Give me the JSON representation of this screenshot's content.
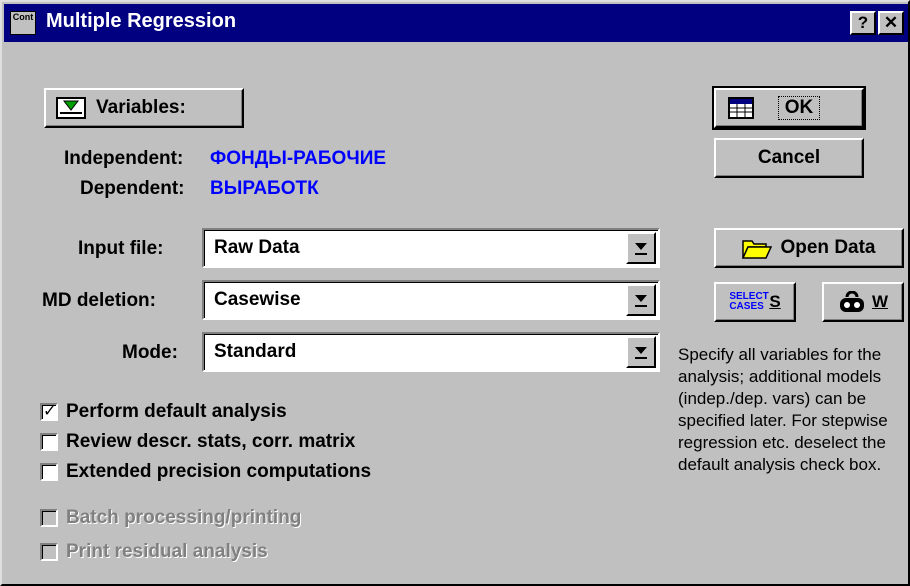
{
  "window": {
    "icon_text": "Cont",
    "title": "Multiple Regression",
    "help_label": "?",
    "close_label": "✕"
  },
  "variables": {
    "button_label": "Variables:",
    "independent_label": "Independent:",
    "independent_value": "ФОНДЫ-РАБОЧИЕ",
    "dependent_label": "Dependent:",
    "dependent_value": "ВЫРАБОТК"
  },
  "actions": {
    "ok_label": "OK",
    "cancel_label": "Cancel",
    "open_data_label": "Open Data",
    "select_cases_icon_text": "SELECT CASES",
    "select_cases_label": "S",
    "weight_label": "W"
  },
  "fields": {
    "input_file_label": "Input file:",
    "input_file_value": "Raw Data",
    "md_deletion_label": "MD deletion:",
    "md_deletion_value": "Casewise",
    "mode_label": "Mode:",
    "mode_value": "Standard"
  },
  "options": [
    {
      "label": "Perform default analysis",
      "checked": true,
      "enabled": true
    },
    {
      "label": "Review descr. stats, corr. matrix",
      "checked": false,
      "enabled": true
    },
    {
      "label": "Extended precision computations",
      "checked": false,
      "enabled": true
    },
    {
      "label": "Batch processing/printing",
      "checked": false,
      "enabled": false
    },
    {
      "label": "Print residual analysis",
      "checked": false,
      "enabled": false
    }
  ],
  "help_text": "Specify all variables for the analysis; additional models (indep./dep. vars) can be specified later.  For stepwise regression etc. deselect the default analysis check box.",
  "colors": {
    "title_bar": "#000080",
    "dialog_face": "#c0c0c0",
    "variable_value": "#0000ff"
  },
  "icons": {
    "variables": "variables-list-icon",
    "ok": "spreadsheet-icon",
    "open_data": "folder-open-icon",
    "weight": "weight-icon"
  }
}
